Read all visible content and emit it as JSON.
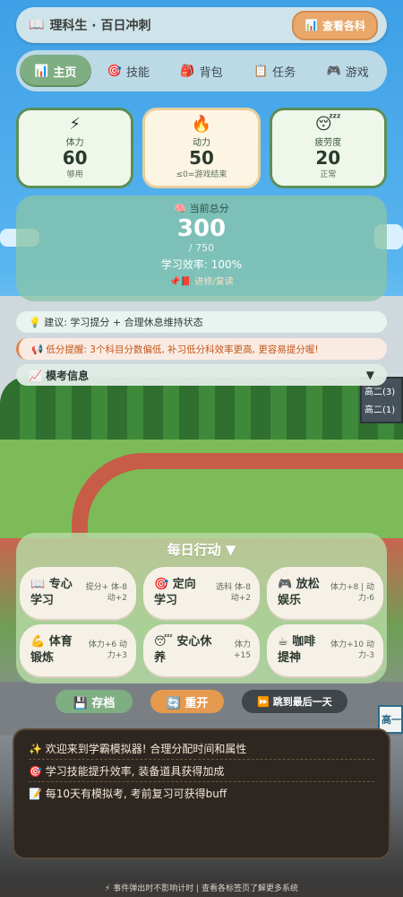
{
  "header": {
    "title": "理科生 · 百日冲刺",
    "title_icon": "book-icon",
    "view_button": "查看各科"
  },
  "nav": {
    "tabs": [
      {
        "label": "主页",
        "icon": "chart-icon",
        "active": true
      },
      {
        "label": "技能",
        "icon": "target-icon",
        "active": false
      },
      {
        "label": "背包",
        "icon": "backpack-icon",
        "active": false
      },
      {
        "label": "任务",
        "icon": "clipboard-icon",
        "active": false
      },
      {
        "label": "游戏",
        "icon": "gamepad-icon",
        "active": false
      }
    ]
  },
  "stats": [
    {
      "icon": "⚡",
      "label": "体力",
      "value": "60",
      "sub": "够用"
    },
    {
      "icon": "🔥",
      "label": "动力",
      "value": "50",
      "sub": "≤0=游戏结束"
    },
    {
      "icon": "😴",
      "label": "疲劳度",
      "value": "20",
      "sub": "正常"
    }
  ],
  "score": {
    "label": "当前总分",
    "value": "300",
    "max": "/ 750",
    "efficiency": "学习效率: 100%",
    "tip": "📌📕 进修/复读"
  },
  "advice": "💡 建议: 学习提分 + 合理休息维持状态",
  "warning": "📢 低分提醒: 3个科目分数偏低, 补习低分科效率更高, 更容易提分喔!",
  "exam": {
    "label": "📈 模考信息",
    "toggle": "▼"
  },
  "board": {
    "line1": "高二(3)",
    "line2": "高二(1)"
  },
  "daily": {
    "title": "每日行动 ▼",
    "actions": [
      {
        "icon": "📖",
        "name": "专心学习",
        "effect": "提分+ 体-8 动+2"
      },
      {
        "icon": "🎯",
        "name": "定向学习",
        "effect": "选科 体-8 动+2"
      },
      {
        "icon": "🎮",
        "name": "放松娱乐",
        "effect": "体力+8 | 动力-6"
      },
      {
        "icon": "💪",
        "name": "体育锻炼",
        "effect": "体力+6 动力+3"
      },
      {
        "icon": "😴",
        "name": "安心休养",
        "effect": "体力+15"
      },
      {
        "icon": "☕",
        "name": "咖啡提神",
        "effect": "体力+10 动力-3"
      }
    ]
  },
  "buttons": {
    "save": "💾 存档",
    "reset": "🔄 重开",
    "skip": "⏩ 跳到最后一天"
  },
  "log": [
    "✨  欢迎来到学霸模拟器! 合理分配时间和属性",
    "🎯  学习技能提升效率, 装备道具获得加成",
    "📝  每10天有模拟考, 考前复习可获得buff"
  ],
  "sign": "高一",
  "footer": "⚡ 事件弹出时不影响计时 | 查看各标签页了解更多系统"
}
